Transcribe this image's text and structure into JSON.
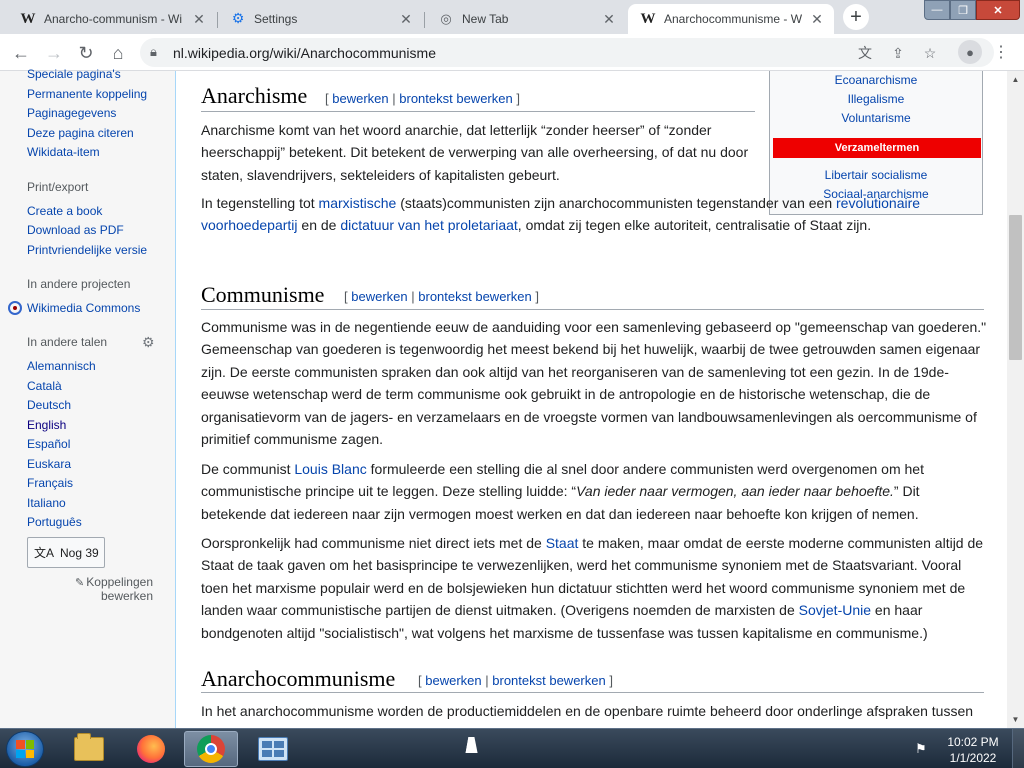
{
  "browser": {
    "tabs": [
      {
        "title": "Anarcho-communism - Wi",
        "favicon": "wikipedia-w"
      },
      {
        "title": "Settings",
        "favicon": "gear-icon"
      },
      {
        "title": "New Tab",
        "favicon": "globe-icon"
      },
      {
        "title": "Anarchocommunisme - W",
        "favicon": "wikipedia-w"
      }
    ],
    "new_tab_label": "+",
    "address": "nl.wikipedia.org/wiki/Anarchocommunisme"
  },
  "sidebar": {
    "tools_links": [
      "Speciale pagina's",
      "Permanente koppeling",
      "Paginagegevens",
      "Deze pagina citeren",
      "Wikidata-item"
    ],
    "print_head": "Print/export",
    "print_links": [
      "Create a book",
      "Download as PDF",
      "Printvriendelijke versie"
    ],
    "projects_head": "In andere projecten",
    "commons_link": "Wikimedia Commons",
    "languages_head": "In andere talen",
    "languages": [
      "Alemannisch",
      "Català",
      "Deutsch",
      "English",
      "Español",
      "Euskara",
      "Français",
      "Italiano",
      "Português"
    ],
    "more_languages": "Nog 39",
    "edit_links": "Koppelingen bewerken"
  },
  "infobox": {
    "links_top": [
      "Ecoanarchisme",
      "Illegalisme",
      "Voluntarisme"
    ],
    "bar": "Verzameltermen",
    "links_bottom": [
      "Libertair socialisme",
      "Sociaal-anarchisme"
    ]
  },
  "article": {
    "edit_open": "[",
    "edit_label": "bewerken",
    "edit_sep": "|",
    "source_label": "brontekst bewerken",
    "edit_close": "]",
    "sections": [
      {
        "heading": "Anarchisme",
        "paragraphs": [
          [
            {
              "t": "Anarchisme komt van het woord anarchie, dat letterlijk “zonder heerser” of “zonder heerschappij” betekent. Dit betekent de verwerping van alle overheersing, of dat nu door staten, slavendrijvers, sekteleiders of kapitalisten gebeurt."
            }
          ],
          [
            {
              "t": "In tegenstelling tot "
            },
            {
              "t": "marxistische",
              "link": true
            },
            {
              "t": " (staats)communisten zijn anarchocommunisten tegenstander van een "
            },
            {
              "t": "revolutionaire voorhoedepartij",
              "link": true
            },
            {
              "t": " en de "
            },
            {
              "t": "dictatuur van het proletariaat",
              "link": true
            },
            {
              "t": ", omdat zij tegen elke autoriteit, centralisatie of Staat zijn."
            }
          ]
        ]
      },
      {
        "heading": "Communisme",
        "paragraphs": [
          [
            {
              "t": "Communisme was in de negentiende eeuw de aanduiding voor een samenleving gebaseerd op \"gemeenschap van goederen.\" Gemeenschap van goederen is tegenwoordig het meest bekend bij het huwelijk, waarbij de twee getrouwden samen eigenaar zijn. De eerste communisten spraken dan ook altijd van het reorganiseren van de samenleving tot een gezin. In de 19de-eeuwse wetenschap werd de term communisme ook gebruikt in de antropologie en de historische wetenschap, die de organisatievorm van de jagers- en verzamelaars en de vroegste vormen van landbouwsamenlevingen als oercommunisme of primitief communisme zagen."
            }
          ],
          [
            {
              "t": "De communist "
            },
            {
              "t": "Louis Blanc",
              "link": true
            },
            {
              "t": " formuleerde een stelling die al snel door andere communisten werd overgenomen om het communistische principe uit te leggen. Deze stelling luidde: “"
            },
            {
              "t": "Van ieder naar vermogen, aan ieder naar behoefte.",
              "italic": true
            },
            {
              "t": "” Dit betekende dat iedereen naar zijn vermogen moest werken en dat dan iedereen naar behoefte kon krijgen of nemen."
            }
          ],
          [
            {
              "t": "Oorspronkelijk had communisme niet direct iets met de "
            },
            {
              "t": "Staat",
              "link": true
            },
            {
              "t": " te maken, maar omdat de eerste moderne communisten altijd de Staat de taak gaven om het basisprincipe te verwezenlijken, werd het communisme synoniem met de Staatsvariant. Vooral toen het marxisme populair werd en de bolsjewieken hun dictatuur stichtten werd het woord communisme synoniem met de landen waar communistische partijen de dienst uitmaken. (Overigens noemden de marxisten de "
            },
            {
              "t": "Sovjet-Unie",
              "link": true
            },
            {
              "t": " en haar bondgenoten altijd \"socialistisch\", wat volgens het marxisme de tussenfase was tussen kapitalisme en communisme.)"
            }
          ]
        ]
      },
      {
        "heading": "Anarchocommunisme",
        "paragraphs": [
          [
            {
              "t": "In het anarchocommunisme worden de productiemiddelen en de openbare ruimte beheerd door onderlinge afspraken tussen"
            }
          ]
        ]
      }
    ]
  },
  "taskbar": {
    "apps": [
      "start-button",
      "file-explorer",
      "firefox",
      "chrome",
      "control-panel"
    ],
    "clock_time": "10:02 PM",
    "clock_date": "1/1/2022"
  },
  "colors": {
    "link": "#0645ad",
    "infobox_bar": "#ee0000",
    "tabstrip": "#dee1e6"
  }
}
